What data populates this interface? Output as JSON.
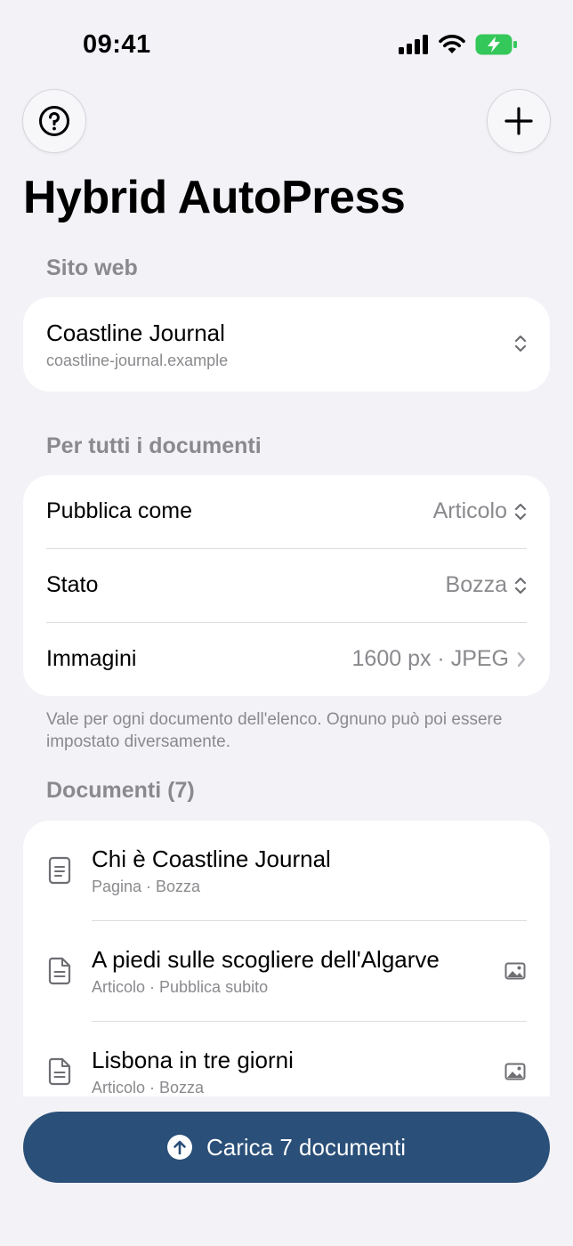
{
  "status_bar": {
    "time": "09:41"
  },
  "app": {
    "title": "Hybrid AutoPress"
  },
  "site_section": {
    "header": "Sito web",
    "site_name": "Coastline Journal",
    "site_url": "coastline-journal.example"
  },
  "defaults_section": {
    "header": "Per tutti i documenti",
    "rows": [
      {
        "label": "Pubblica come",
        "value": "Articolo",
        "accessory": "chevron-up-down-icon"
      },
      {
        "label": "Stato",
        "value": "Bozza",
        "accessory": "chevron-up-down-icon"
      },
      {
        "label": "Immagini",
        "value": "1600 px · JPEG",
        "accessory": "chevron-right-icon"
      }
    ],
    "note": "Vale per ogni documento dell'elenco. Ognuno può poi essere impostato diversamente."
  },
  "documents_section": {
    "header": "Documenti (7)",
    "items": [
      {
        "title": "Chi è Coastline Journal",
        "meta": "Pagina · Bozza",
        "icon": "page-icon",
        "has_image": false
      },
      {
        "title": "A piedi sulle scogliere dell'Algarve",
        "meta": "Articolo · Pubblica subito",
        "icon": "document-icon",
        "has_image": true
      },
      {
        "title": "Lisbona in tre giorni",
        "meta": "Articolo · Bozza",
        "icon": "document-icon",
        "has_image": true
      }
    ]
  },
  "upload_button": {
    "label": "Carica 7 documenti"
  },
  "colors": {
    "accent": "#2a4f78",
    "battery": "#34c759",
    "background": "#f2f2f7"
  }
}
